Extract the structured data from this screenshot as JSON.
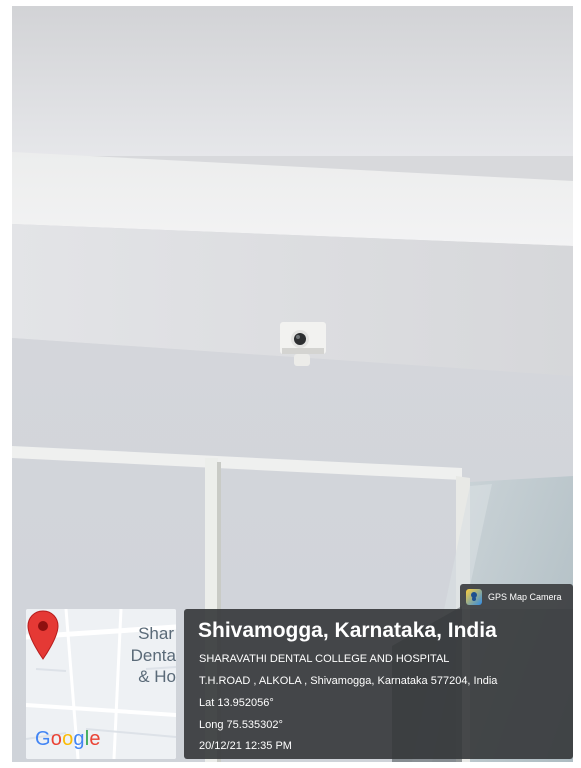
{
  "map": {
    "labels": [
      "Shar",
      "Denta",
      "& Ho"
    ],
    "logo_letters": [
      {
        "ch": "G",
        "color": "#4285F4"
      },
      {
        "ch": "o",
        "color": "#EA4335"
      },
      {
        "ch": "o",
        "color": "#FBBC05"
      },
      {
        "ch": "g",
        "color": "#4285F4"
      },
      {
        "ch": "l",
        "color": "#34A853"
      },
      {
        "ch": "e",
        "color": "#EA4335"
      }
    ],
    "pin_color": "#e53935"
  },
  "badge": {
    "label": "GPS Map Camera",
    "icon": "gps-map-camera-icon"
  },
  "info": {
    "title": "Shivamogga, Karnataka, India",
    "place": "SHARAVATHI DENTAL COLLEGE AND HOSPITAL",
    "address": "T.H.ROAD , ALKOLA , Shivamogga, Karnataka 577204, India",
    "lat": "Lat 13.952056°",
    "long": "Long 75.535302°",
    "datetime": "20/12/21 12:35 PM"
  }
}
